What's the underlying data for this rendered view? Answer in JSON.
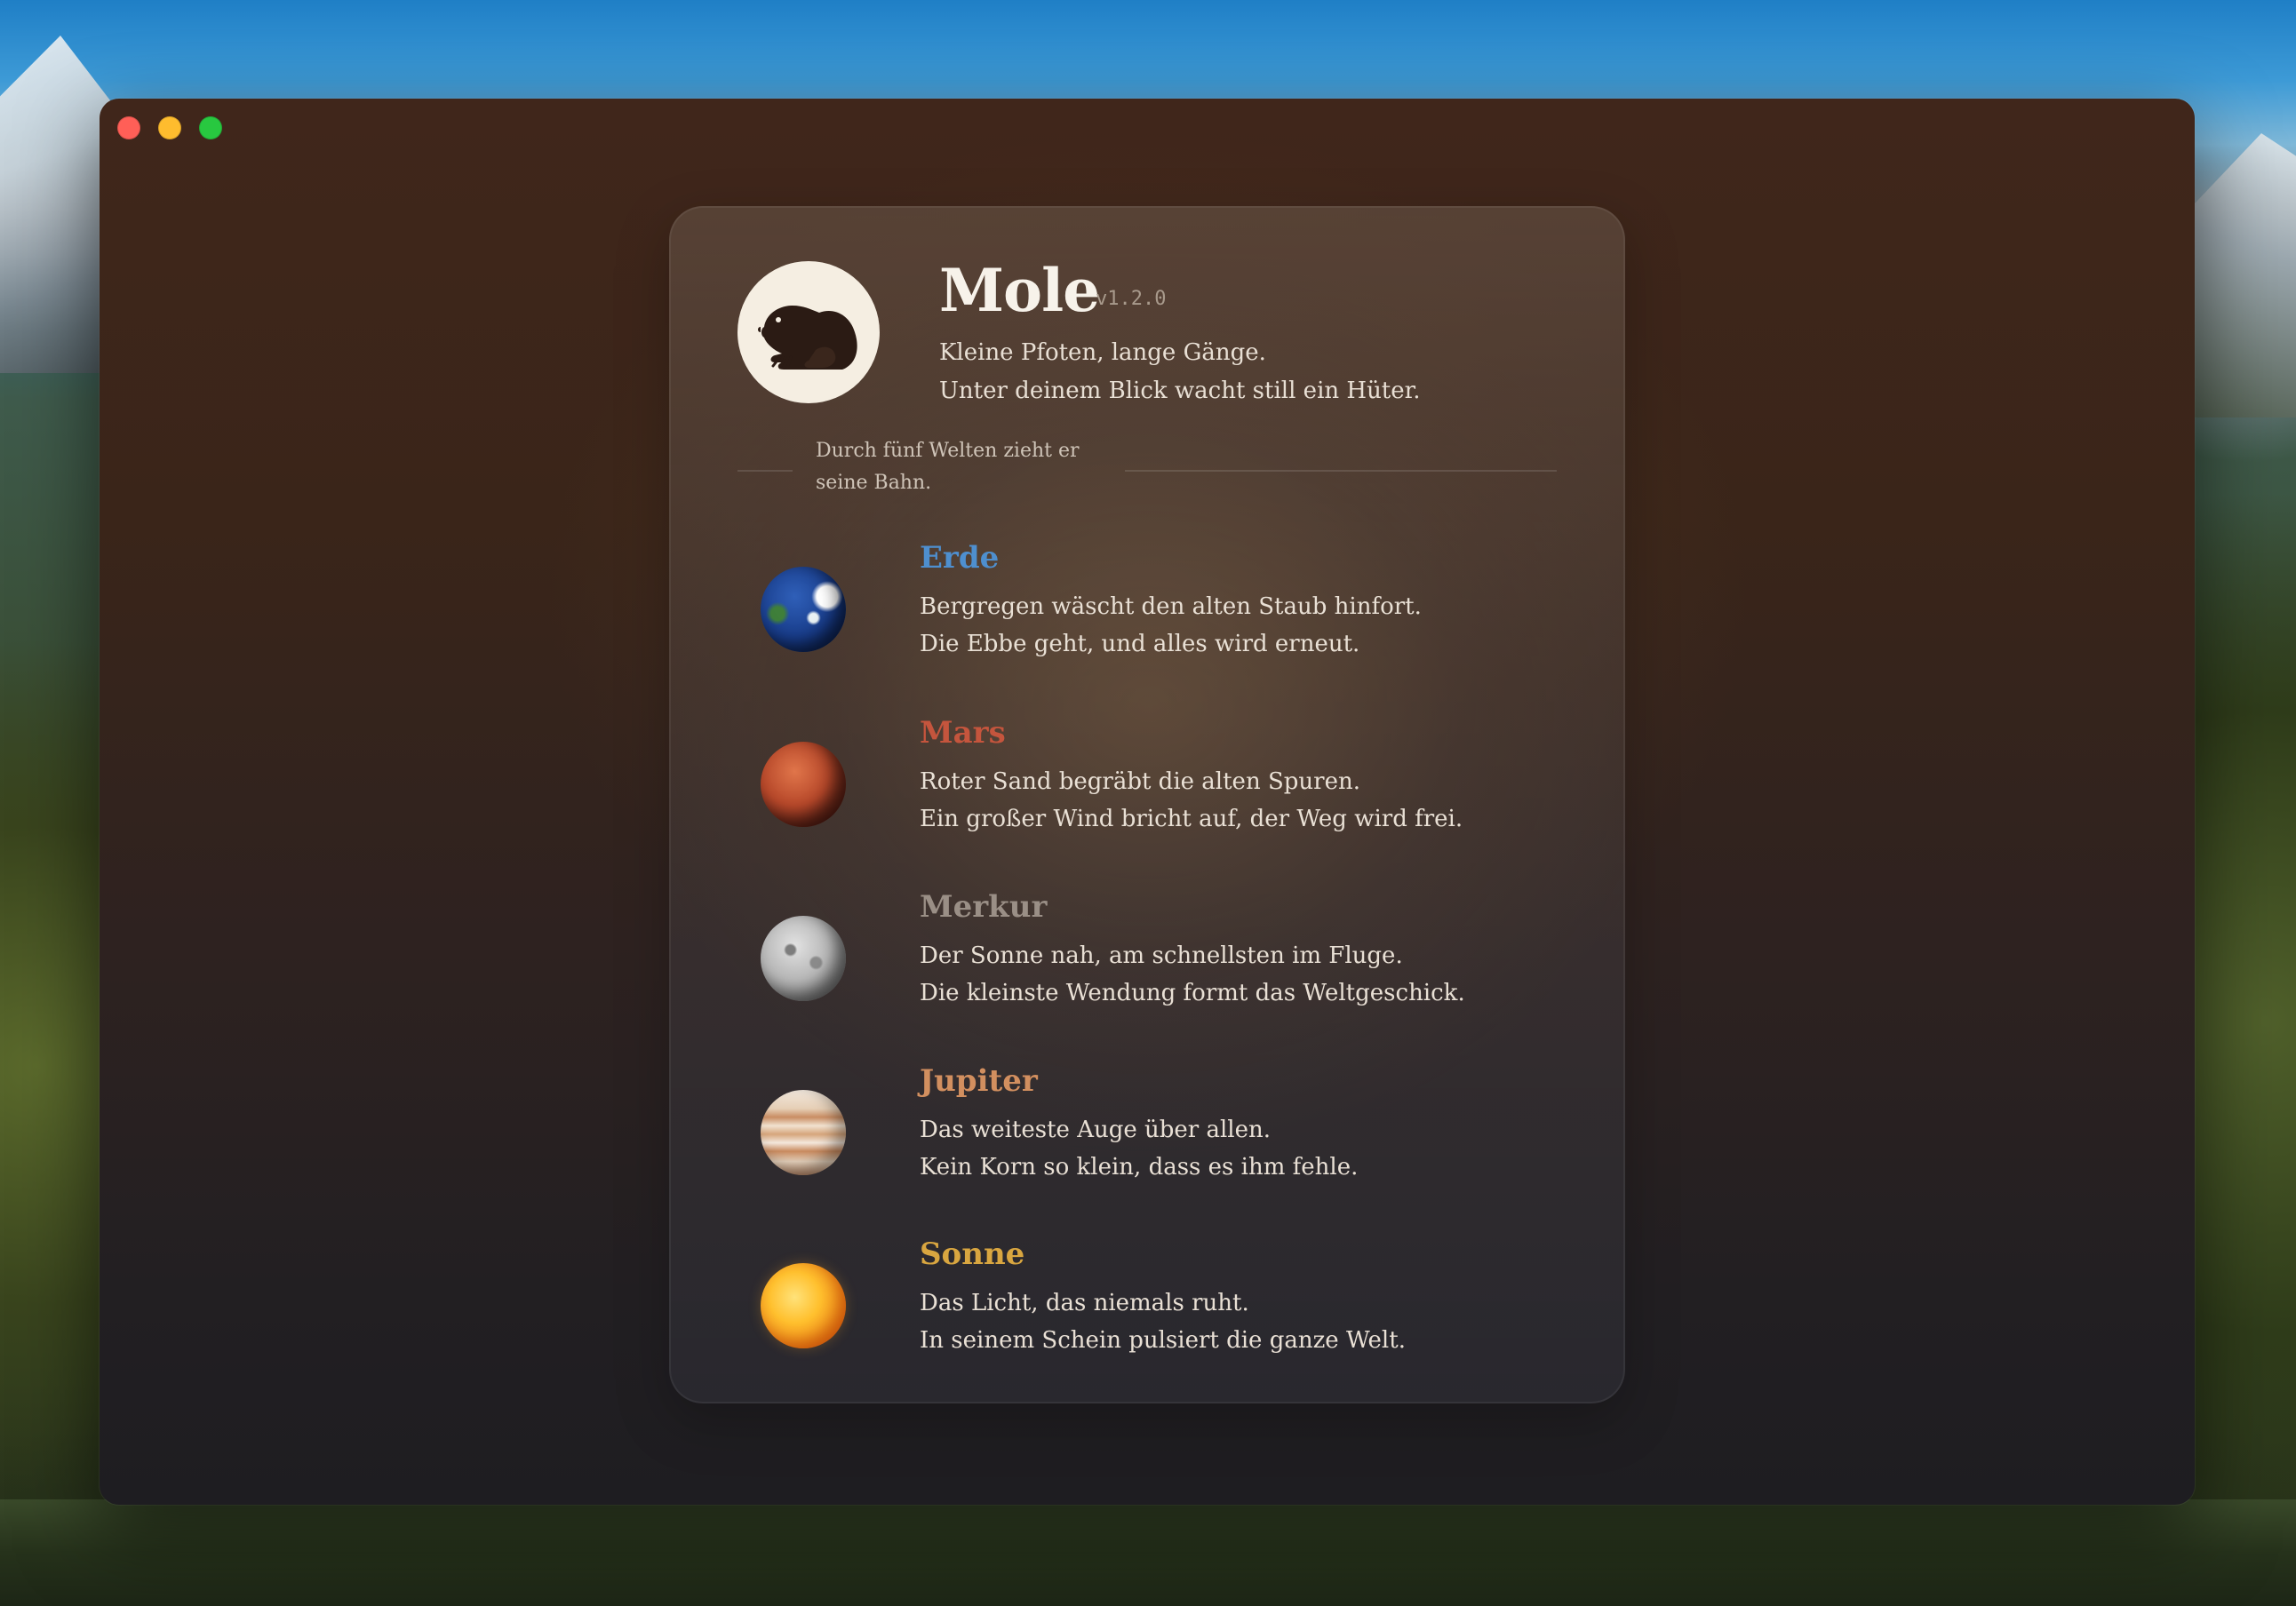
{
  "window": {
    "controls": [
      "close",
      "minimize",
      "maximize"
    ]
  },
  "app": {
    "name": "Mole",
    "version": "v1.2.0",
    "logo_icon": "mole-icon",
    "tagline_line1": "Kleine Pfoten, lange Gänge.",
    "tagline_line2": "Unter deinem Blick wacht still ein Hüter."
  },
  "section": {
    "note": "Durch fünf Welten zieht er seine Bahn."
  },
  "planets": [
    {
      "name": "Erde",
      "color": "#4e8fcf",
      "icon": "earth-icon",
      "line1": "Bergregen wäscht den alten Staub hinfort.",
      "line2": "Die Ebbe geht, und alles wird erneut."
    },
    {
      "name": "Mars",
      "color": "#c5553d",
      "icon": "mars-icon",
      "line1": "Roter Sand begräbt die alten Spuren.",
      "line2": "Ein großer Wind bricht auf, der Weg wird frei."
    },
    {
      "name": "Merkur",
      "color": "#9a8f86",
      "icon": "mercury-icon",
      "line1": "Der Sonne nah, am schnellsten im Fluge.",
      "line2": "Die kleinste Wendung formt das Weltgeschick."
    },
    {
      "name": "Jupiter",
      "color": "#d28f5f",
      "icon": "jupiter-icon",
      "line1": "Das weiteste Auge über allen.",
      "line2": "Kein Korn so klein, dass es ihm fehle."
    },
    {
      "name": "Sonne",
      "color": "#d9a640",
      "icon": "sun-icon",
      "line1": "Das Licht, das niemals ruht.",
      "line2": "In seinem Schein pulsiert die ganze Welt."
    }
  ]
}
